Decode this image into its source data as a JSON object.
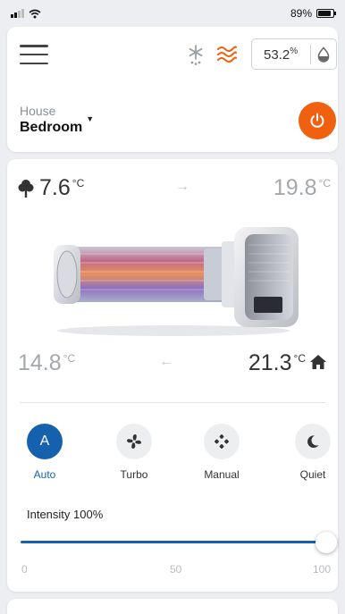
{
  "status_bar": {
    "battery": "89%",
    "battery_level": 0.89
  },
  "top": {
    "humidity_value": "53.2",
    "humidity_unit": "%",
    "house_label": "House",
    "room_label": "Bedroom",
    "power_color": "#f0600f",
    "heat_color": "#f0600f"
  },
  "temps": {
    "outside_in": {
      "value": "7.6",
      "unit": "°C"
    },
    "supply": {
      "value": "19.8",
      "unit": "°C"
    },
    "exhaust": {
      "value": "14.8",
      "unit": "°C"
    },
    "inside": {
      "value": "21.3",
      "unit": "°C"
    }
  },
  "modes": [
    {
      "letter": "A",
      "label": "Auto",
      "active": true
    },
    {
      "label": "Turbo",
      "icon": "fan-icon"
    },
    {
      "label": "Manual",
      "icon": "manual-dots-icon"
    },
    {
      "label": "Quiet",
      "icon": "moon-icon"
    }
  ],
  "intensity": {
    "label": "Intensity 100%",
    "value": 100,
    "min_label": "0",
    "mid_label": "50",
    "max_label": "100"
  },
  "accent_color": "#1661ad"
}
